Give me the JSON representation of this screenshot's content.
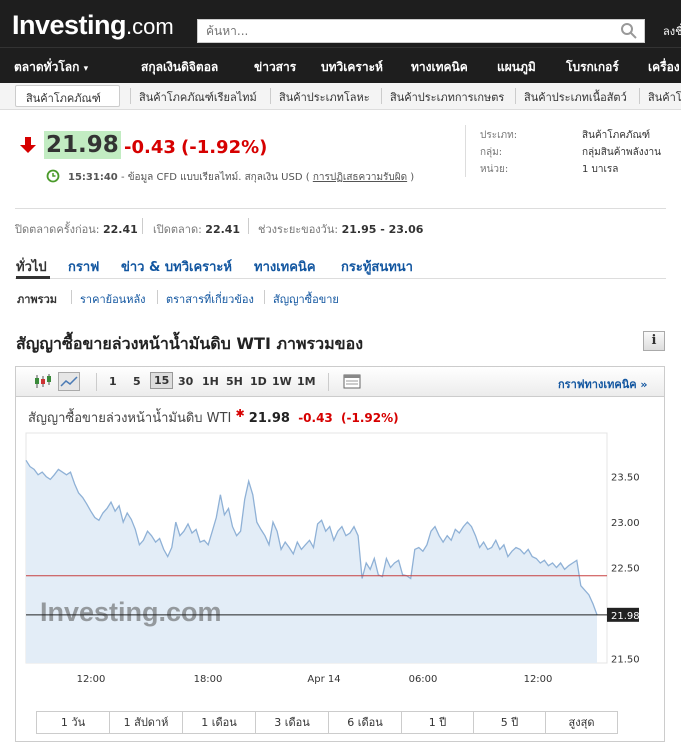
{
  "header": {
    "logo_main": "Investing",
    "logo_suffix": ".com",
    "search_placeholder": "ค้นหา...",
    "signin": "ลงชื่อเข้าใช้"
  },
  "nav": [
    "ตลาดทั่วโลก",
    "สกุลเงินดิจิตอล",
    "ข่าวสาร",
    "บทวิเคราะห์",
    "ทางเทคนิค",
    "แผนภูมิ",
    "โบรกเกอร์",
    "เครื่อง"
  ],
  "subnav": [
    "สินค้าโภคภัณฑ์",
    "สินค้าโภคภัณฑ์เรียลไทม์",
    "สินค้าประเภทโลหะ",
    "สินค้าประเภทการเกษตร",
    "สินค้าประเภทเนื้อสัตว์",
    "สินค้าโภ"
  ],
  "quote": {
    "price": "21.98",
    "change": "-0.43",
    "change_pct": "(-1.92%)",
    "time": "15:31:40",
    "time_note": "- ข้อมูล CFD แบบเรียลไทม์. สกุลเงิน USD",
    "disclaimer_link": "การปฏิเสธความรับผิด",
    "colors": {
      "down": "#d60000",
      "price_bg": "#c2ecc2"
    }
  },
  "meta": {
    "type_label": "ประเภท:",
    "type_value": "สินค้าโภคภัณฑ์",
    "group_label": "กลุ่ม:",
    "group_value": "กลุ่มสินค้าพลังงาน",
    "unit_label": "หน่วย:",
    "unit_value": "1 บาเรล"
  },
  "stats": {
    "prev_close_label": "ปิดตลาดครั้งก่อน:",
    "prev_close": "22.41",
    "open_label": "เปิดตลาด:",
    "open": "22.41",
    "day_range_label": "ช่วงระยะของวัน:",
    "day_range": "21.95 - 23.06"
  },
  "tabs": [
    "ทั่วไป",
    "กราฟ",
    "ข่าว & บทวิเคราะห์",
    "ทางเทคนิค",
    "กระทู้สนทนา"
  ],
  "subtabs": [
    "ภาพรวม",
    "ราคาย้อนหลัง",
    "ตราสารที่เกี่ยวข้อง",
    "สัญญาซื้อขาย"
  ],
  "section_title": "สัญญาซื้อขายล่วงหน้าน้ำมันดิบ WTI ภาพรวมของ",
  "chart_toolbar": {
    "intervals": [
      "1",
      "5",
      "15",
      "30",
      "1H",
      "5H",
      "1D",
      "1W",
      "1M"
    ],
    "active_interval": "15",
    "tech_link": "กราฟทางเทคนิค »"
  },
  "chart_legend": {
    "name": "สัญญาซื้อขายล่วงหน้าน้ำมันดิบ WTI",
    "price": "21.98",
    "change": "-0.43",
    "change_pct": "(-1.92%)"
  },
  "ranges": [
    "1 วัน",
    "1 สัปดาห์",
    "1 เดือน",
    "3 เดือน",
    "6 เดือน",
    "1 ปี",
    "5 ปี",
    "สูงสุด"
  ],
  "chart_data": {
    "type": "area",
    "title": "",
    "xlabel": "",
    "ylabel": "",
    "x_ticks": [
      "12:00",
      "18:00",
      "Apr 14",
      "06:00",
      "12:00"
    ],
    "y_ticks": [
      23.5,
      23.0,
      22.5,
      21.5
    ],
    "ylim": [
      21.45,
      23.98
    ],
    "reference_line": 22.41,
    "last_value": 21.98,
    "last_value_label": "21.98",
    "watermark": "Investing.com",
    "colors": {
      "line": "#8fb1d6",
      "fill": "#e3edf7",
      "ref": "#c84040"
    },
    "series": [
      {
        "values": [
          23.68,
          23.61,
          23.58,
          23.52,
          23.55,
          23.5,
          23.47,
          23.52,
          23.58,
          23.55,
          23.52,
          23.55,
          23.42,
          23.32,
          23.27,
          23.2,
          23.12,
          23.05,
          23.02,
          23.1,
          23.15,
          23.22,
          23.12,
          23.18,
          23.0,
          23.1,
          23.03,
          22.92,
          22.75,
          22.8,
          22.9,
          22.85,
          22.78,
          22.82,
          22.7,
          22.62,
          22.72,
          23.0,
          22.85,
          22.9,
          22.98,
          22.88,
          22.92,
          22.78,
          22.8,
          22.75,
          22.9,
          23.05,
          23.3,
          23.08,
          23.15,
          22.95,
          22.85,
          22.9,
          23.25,
          23.45,
          23.3,
          23.0,
          22.92,
          22.85,
          22.75,
          23.0,
          22.9,
          22.7,
          22.78,
          22.72,
          22.65,
          22.78,
          22.7,
          22.75,
          22.8,
          22.72,
          22.98,
          23.02,
          22.9,
          22.95,
          22.8,
          22.9,
          22.95,
          22.85,
          22.88,
          22.95,
          22.85,
          22.38,
          22.55,
          22.48,
          22.6,
          22.42,
          22.4,
          22.6,
          22.5,
          22.55,
          22.58,
          22.42,
          22.41,
          22.38,
          22.7,
          22.72,
          22.68,
          22.75,
          22.9,
          22.95,
          22.85,
          22.78,
          22.85,
          22.8,
          22.92,
          22.88,
          22.95,
          23.0,
          22.95,
          22.85,
          22.72,
          22.78,
          22.7,
          22.72,
          22.8,
          22.7,
          22.75,
          22.62,
          22.68,
          22.72,
          22.7,
          22.65,
          22.7,
          22.62,
          22.6,
          22.55,
          22.58,
          22.52,
          22.55,
          22.5,
          22.55,
          22.48,
          22.52,
          22.55,
          22.58,
          22.3,
          22.25,
          22.2,
          22.1,
          21.98
        ]
      }
    ]
  }
}
